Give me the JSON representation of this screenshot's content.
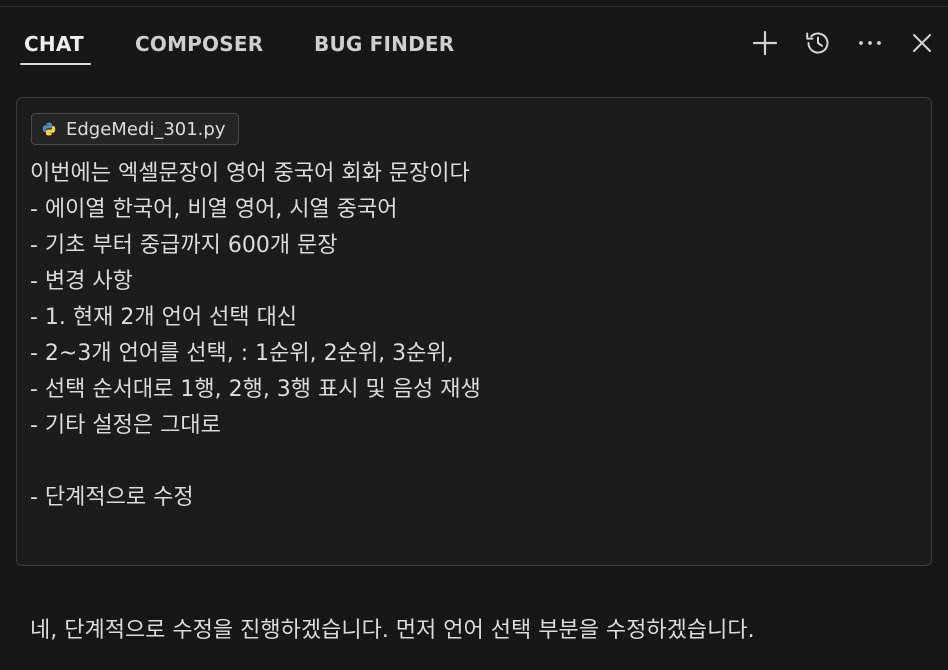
{
  "tabs": [
    {
      "label": "CHAT",
      "active": true
    },
    {
      "label": "COMPOSER",
      "active": false
    },
    {
      "label": "BUG FINDER",
      "active": false
    }
  ],
  "toolbar": {
    "icons": [
      "plus-icon",
      "history-icon",
      "more-icon",
      "close-icon"
    ]
  },
  "prompt": {
    "attachment": {
      "filename": "EdgeMedi_301.py",
      "icon": "python-icon"
    },
    "lines": [
      "이번에는 엑셀문장이 영어 중국어 회화 문장이다",
      "- 에이열 한국어, 비열 영어, 시열 중국어",
      "- 기초 부터 중급까지 600개 문장",
      "- 변경 사항",
      "- 1. 현재 2개 언어 선택 대신",
      "- 2~3개 언어를 선택, : 1순위, 2순위, 3순위,",
      "- 선택 순서대로 1행, 2행, 3행 표시 및 음성 재생",
      "- 기타 설정은 그대로",
      "",
      "- 단계적으로 수정"
    ]
  },
  "response": {
    "text": "네, 단계적으로 수정을 진행하겠습니다. 먼저 언어 선택 부분을 수정하겠습니다."
  },
  "colors": {
    "background": "#171717",
    "panel": "#1c1c1c",
    "border": "#3b3b3b",
    "text": "#dcdcdc",
    "python_blue": "#4b8bbe",
    "python_yellow": "#ffd43b"
  }
}
